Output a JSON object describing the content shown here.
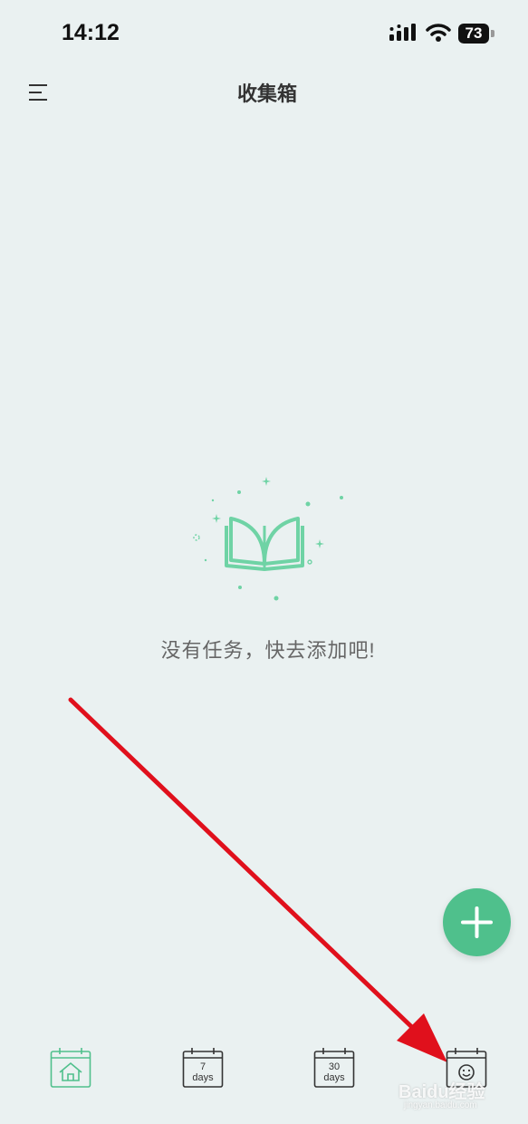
{
  "status_bar": {
    "time": "14:12",
    "battery": "73",
    "icons": [
      "signal-icon",
      "wifi-icon",
      "battery-icon"
    ]
  },
  "header": {
    "title": "收集箱",
    "menu_icon": "menu-icon"
  },
  "empty_state": {
    "icon": "open-book-icon",
    "message": "没有任务，快去添加吧!"
  },
  "fab": {
    "icon": "plus-icon"
  },
  "tabs": [
    {
      "name": "home",
      "icon": "calendar-home-icon",
      "line1": "",
      "line2": "",
      "active": true
    },
    {
      "name": "7-days",
      "icon": "calendar-icon",
      "line1": "7",
      "line2": "days",
      "active": false
    },
    {
      "name": "30-days",
      "icon": "calendar-icon",
      "line1": "30",
      "line2": "days",
      "active": false
    },
    {
      "name": "smile",
      "icon": "calendar-smile-icon",
      "line1": "",
      "line2": "",
      "active": false
    }
  ],
  "watermark": {
    "text": "Baidu经验",
    "sub": "jingyan.baidu.com"
  },
  "colors": {
    "background": "#eaf1f1",
    "accent": "#4fc08c",
    "illustration": "#6fd3a5",
    "annotation_arrow": "#e0101c"
  }
}
